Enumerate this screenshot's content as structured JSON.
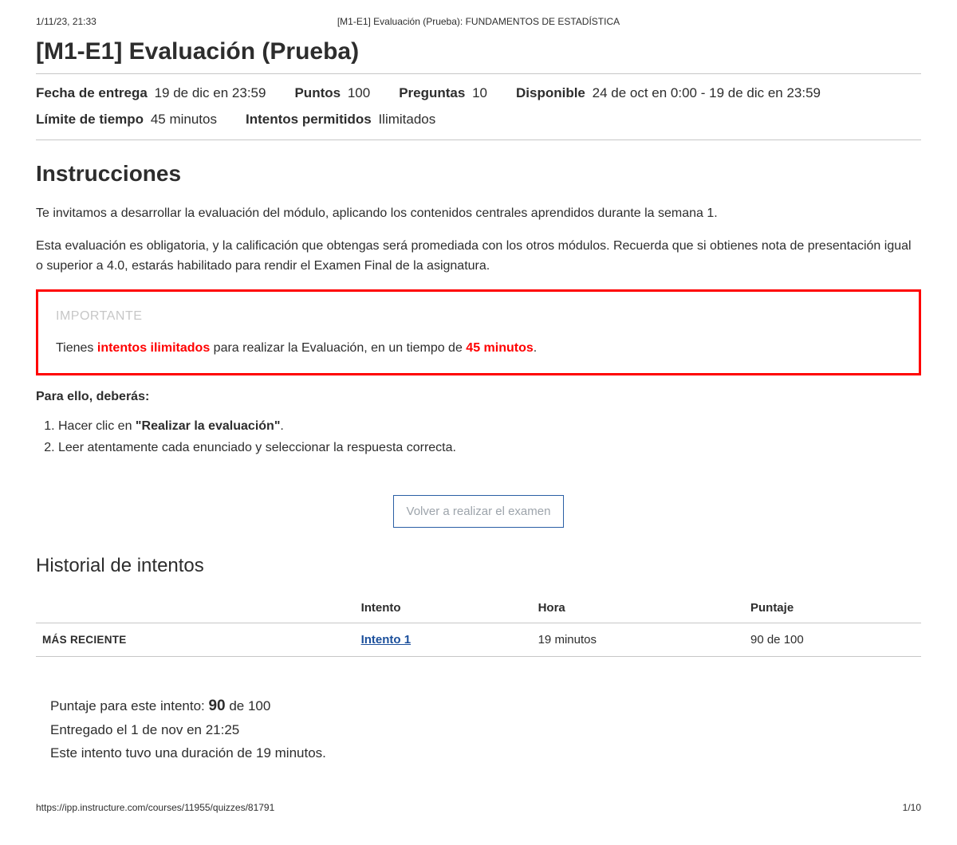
{
  "print_header": {
    "left": "1/11/23, 21:33",
    "center": "[M1-E1] Evaluación (Prueba): FUNDAMENTOS DE ESTADÍSTICA"
  },
  "page_title": "[M1-E1] Evaluación (Prueba)",
  "meta": {
    "due_label": "Fecha de entrega",
    "due_value": "19 de dic en 23:59",
    "points_label": "Puntos",
    "points_value": "100",
    "questions_label": "Preguntas",
    "questions_value": "10",
    "available_label": "Disponible",
    "available_value": "24 de oct en 0:00 - 19 de dic en 23:59",
    "timelimit_label": "Límite de tiempo",
    "timelimit_value": "45 minutos",
    "attempts_label": "Intentos permitidos",
    "attempts_value": "Ilimitados"
  },
  "instructions": {
    "heading": "Instrucciones",
    "p1": "Te invitamos a desarrollar la evaluación del módulo, aplicando los contenidos centrales aprendidos durante la semana 1.",
    "p2": "Esta evaluación es obligatoria, y la calificación que obtengas será promediada con los otros módulos. Recuerda que si obtienes nota de presentación igual o superior a 4.0, estarás habilitado para rendir el Examen Final de la asignatura.",
    "important_heading": "IMPORTANTE",
    "important_pre": "Tienes ",
    "important_attempts": "intentos ilimitados",
    "important_mid": " para realizar la Evaluación, en un tiempo de ",
    "important_time": "45 minutos",
    "important_post": ".",
    "subhead": "Para ello, deberás:",
    "step1_pre": "Hacer clic en ",
    "step1_bold": "\"Realizar la evaluación\"",
    "step1_post": ".",
    "step2": "Leer atentamente cada enunciado y seleccionar la respuesta correcta."
  },
  "retake_button": "Volver a realizar el examen",
  "history": {
    "heading": "Historial de intentos",
    "col_attempt": "Intento",
    "col_time": "Hora",
    "col_score": "Puntaje",
    "row_label": "MÁS RECIENTE",
    "attempt_link": "Intento 1",
    "time_value": "19 minutos",
    "score_value": "90 de 100"
  },
  "summary": {
    "score_pre": "Puntaje para este intento: ",
    "score_big": "90",
    "score_post": " de 100",
    "submitted": "Entregado el 1 de nov en 21:25",
    "duration": "Este intento tuvo una duración de 19 minutos."
  },
  "print_footer": {
    "left": "https://ipp.instructure.com/courses/11955/quizzes/81791",
    "right": "1/10"
  }
}
